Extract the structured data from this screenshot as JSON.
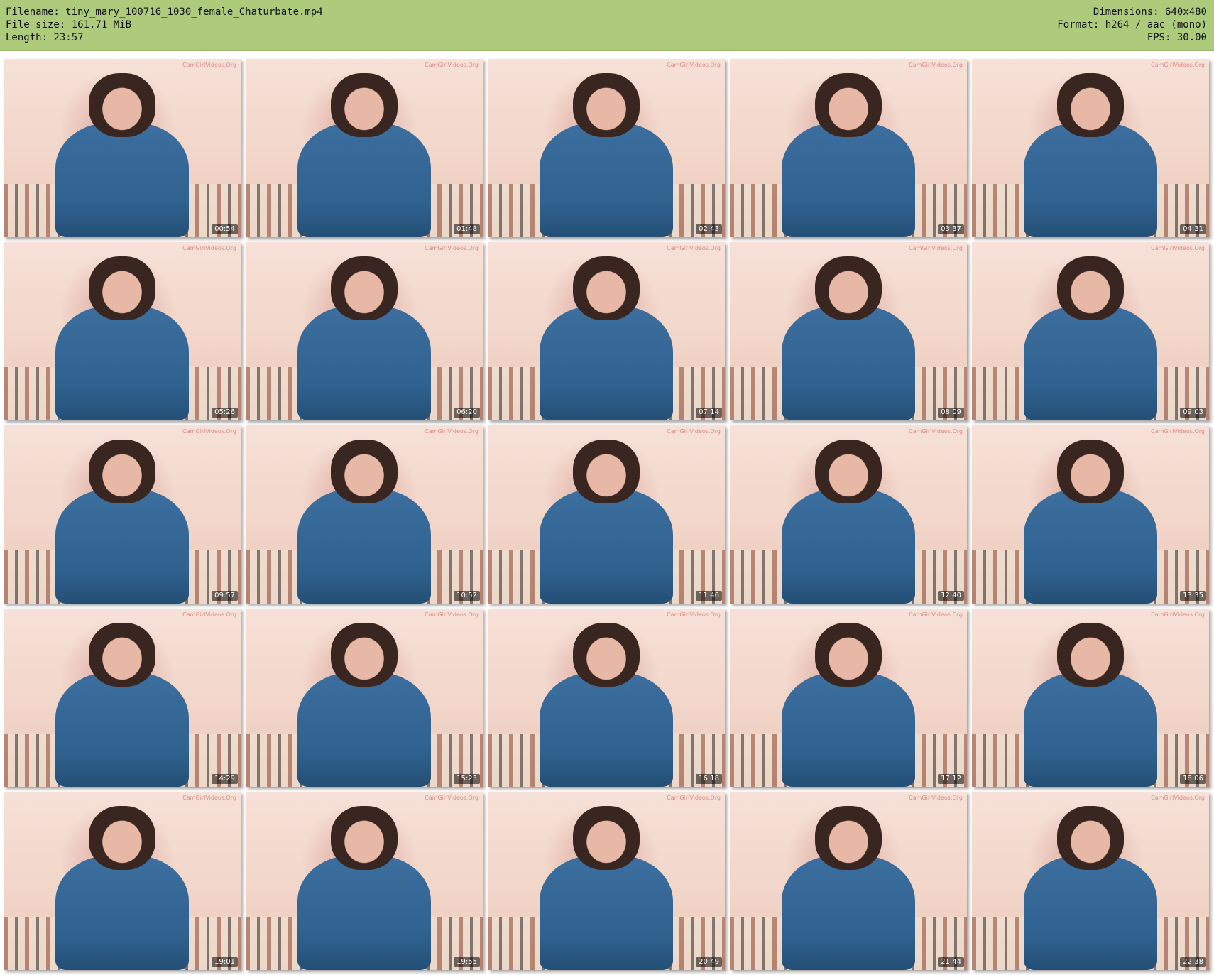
{
  "header": {
    "filename_label": "Filename: tiny_mary_100716_1030_female_Chaturbate.mp4",
    "filesize_label": "File size: 161.71 MiB",
    "length_label": "Length: 23:57",
    "dimensions_label": "Dimensions: 640x480",
    "format_label": "Format: h264 / aac (mono)",
    "fps_label": "FPS: 30.00"
  },
  "colors": {
    "header_bg": "#aecb7c",
    "shirt": "#3c6f9f",
    "wall": "#f3d9ce"
  },
  "thumbnails": [
    {
      "timestamp": "00:54",
      "watermark": "CamGirlVideos.Org"
    },
    {
      "timestamp": "01:48",
      "watermark": "CamGirlVideos.Org"
    },
    {
      "timestamp": "02:43",
      "watermark": "CamGirlVideos.Org"
    },
    {
      "timestamp": "03:37",
      "watermark": "CamGirlVideos.Org"
    },
    {
      "timestamp": "04:31",
      "watermark": "CamGirlVideos.Org"
    },
    {
      "timestamp": "05:26",
      "watermark": "CamGirlVideos.Org"
    },
    {
      "timestamp": "06:20",
      "watermark": "CamGirlVideos.Org"
    },
    {
      "timestamp": "07:14",
      "watermark": "CamGirlVideos.Org"
    },
    {
      "timestamp": "08:09",
      "watermark": "CamGirlVideos.Org"
    },
    {
      "timestamp": "09:03",
      "watermark": "CamGirlVideos.Org"
    },
    {
      "timestamp": "09:57",
      "watermark": "CamGirlVideos.Org"
    },
    {
      "timestamp": "10:52",
      "watermark": "CamGirlVideos.Org"
    },
    {
      "timestamp": "11:46",
      "watermark": "CamGirlVideos.Org"
    },
    {
      "timestamp": "12:40",
      "watermark": "CamGirlVideos.Org"
    },
    {
      "timestamp": "13:35",
      "watermark": "CamGirlVideos.Org"
    },
    {
      "timestamp": "14:29",
      "watermark": "CamGirlVideos.Org"
    },
    {
      "timestamp": "15:23",
      "watermark": "CamGirlVideos.Org"
    },
    {
      "timestamp": "16:18",
      "watermark": "CamGirlVideos.Org"
    },
    {
      "timestamp": "17:12",
      "watermark": "CamGirlVideos.Org"
    },
    {
      "timestamp": "18:06",
      "watermark": "CamGirlVideos.Org"
    },
    {
      "timestamp": "19:01",
      "watermark": "CamGirlVideos.Org"
    },
    {
      "timestamp": "19:55",
      "watermark": "CamGirlVideos.Org"
    },
    {
      "timestamp": "20:49",
      "watermark": "CamGirlVideos.Org"
    },
    {
      "timestamp": "21:44",
      "watermark": "CamGirlVideos.Org"
    },
    {
      "timestamp": "22:38",
      "watermark": "CamGirlVideos.Org"
    }
  ]
}
